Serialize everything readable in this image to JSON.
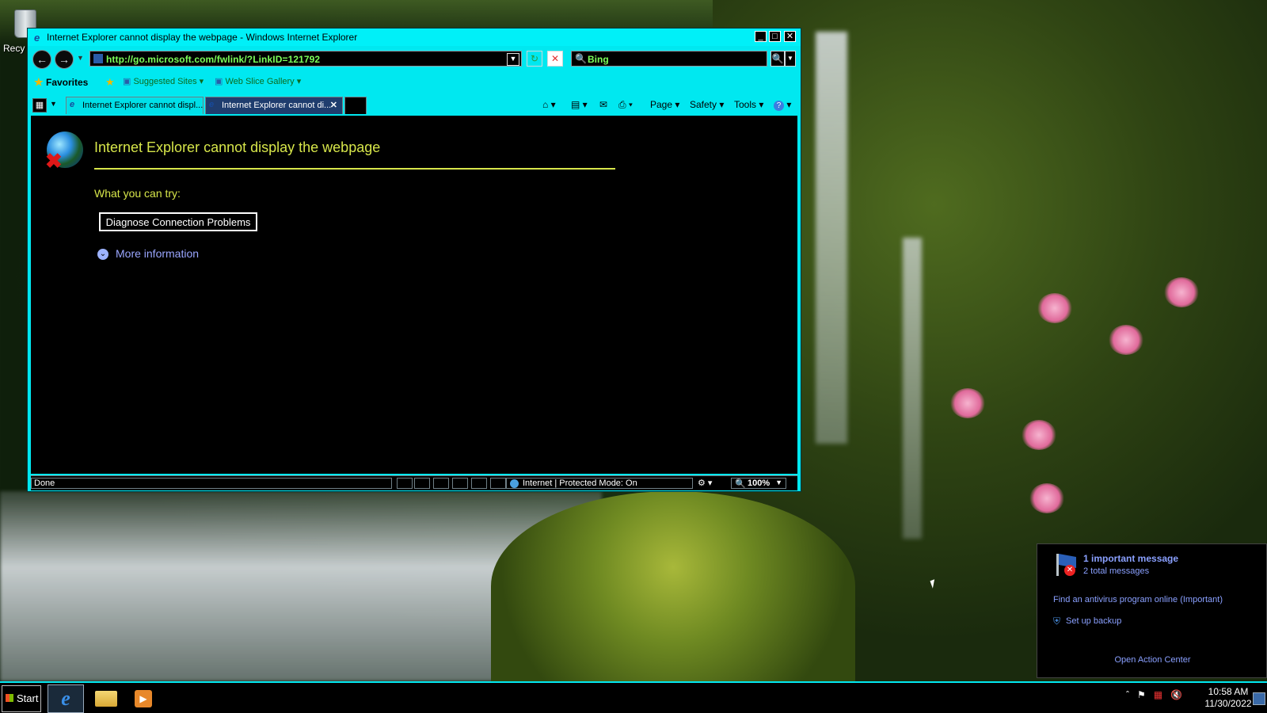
{
  "desktop": {
    "recycle_bin_label": "Recy"
  },
  "window": {
    "title": "Internet Explorer cannot display the webpage - Windows Internet Explorer",
    "controls": {
      "minimize": "_",
      "maximize": "□",
      "close": "✕"
    }
  },
  "address_bar": {
    "url": "http://go.microsoft.com/fwlink/?LinkID=121792",
    "search_text": "Bing"
  },
  "favorites_bar": {
    "favorites_label": "Favorites",
    "items": [
      "Suggested Sites",
      "Web Slice Gallery"
    ]
  },
  "tabs": [
    {
      "label": "Internet Explorer cannot displ...",
      "active": false
    },
    {
      "label": "Internet Explorer cannot di...",
      "active": true
    }
  ],
  "command_bar": {
    "page": "Page",
    "safety": "Safety",
    "tools": "Tools",
    "help": "?"
  },
  "page": {
    "title": "Internet Explorer cannot display the webpage",
    "what_you_can_try": "What you can try:",
    "diagnose_button": "Diagnose Connection Problems",
    "more_information": "More information"
  },
  "status_bar": {
    "status": "Done",
    "zone": "Internet | Protected Mode: On",
    "zoom": "100%"
  },
  "action_center": {
    "important": "1 important message",
    "total": "2 total messages",
    "antivirus_link": "Find an antivirus program online (Important)",
    "backup_link": "Set up backup",
    "open_link": "Open Action Center"
  },
  "taskbar": {
    "start_label": "Start",
    "time": "10:58 AM",
    "date": "11/30/2022"
  },
  "colors": {
    "window_frame": "#00e8f0",
    "page_title": "#d7e64a",
    "link": "#9aa6ff",
    "url_text": "#7cff5a"
  }
}
